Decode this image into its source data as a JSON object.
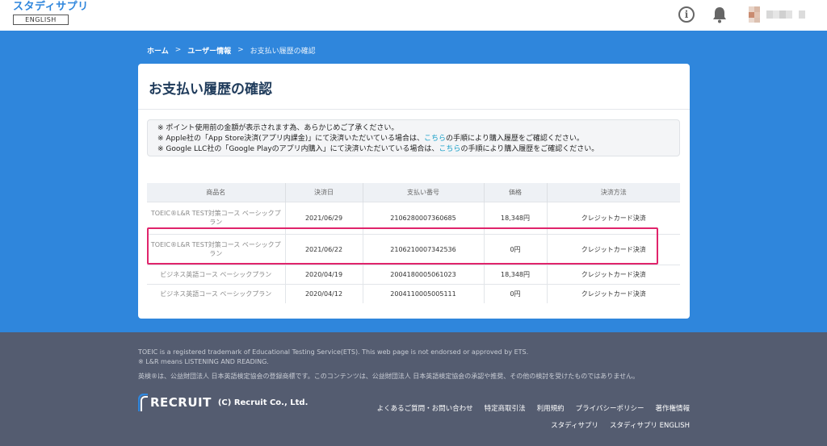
{
  "header": {
    "logo_text": "スタディサプリ",
    "logo_sub": "ENGLISH"
  },
  "breadcrumb": {
    "home": "ホーム",
    "user_info": "ユーザー情報",
    "current": "お支払い履歴の確認",
    "separator": ">"
  },
  "page": {
    "title": "お支払い履歴の確認"
  },
  "notice": {
    "line1": "※ ポイント使用前の金額が表示されます為、あらかじめご了承ください。",
    "line2_pre": "※ Apple社の「App Store決済(アプリ内課金)」にて決済いただいている場合は、",
    "line2_link": "こちら",
    "line2_post": "の手順により購入履歴をご確認ください。",
    "line3_pre": "※ Google LLC社の「Google Playのアプリ内購入」にて決済いただいている場合は、",
    "line3_link": "こちら",
    "line3_post": "の手順により購入履歴をご確認ください。"
  },
  "table": {
    "headers": [
      "商品名",
      "決済日",
      "支払い番号",
      "価格",
      "決済方法"
    ],
    "rows": [
      {
        "product": "TOEIC®L&R TEST対策コース ベーシックプラン",
        "date": "2021/06/29",
        "number": "2106280007360685",
        "price": "18,348円",
        "method": "クレジットカード決済"
      },
      {
        "product": "TOEIC®L&R TEST対策コース ベーシックプラン",
        "date": "2021/06/22",
        "number": "2106210007342536",
        "price": "0円",
        "method": "クレジットカード決済"
      },
      {
        "product": "ビジネス英語コース ベーシックプラン",
        "date": "2020/04/19",
        "number": "2004180005061023",
        "price": "18,348円",
        "method": "クレジットカード決済"
      },
      {
        "product": "ビジネス英語コース ベーシックプラン",
        "date": "2020/04/12",
        "number": "2004110005005111",
        "price": "0円",
        "method": "クレジットカード決済"
      }
    ]
  },
  "footer": {
    "trademark1": "TOEIC is a registered trademark of Educational Testing Service(ETS). This web page is not endorsed or approved by ETS.",
    "trademark2": "※ L&R means LISTENING AND READING.",
    "trademark3": "英検®は、公益財団法人 日本英語検定協会の登録商標です。このコンテンツは、公益財団法人 日本英語検定協会の承認や推奨、その他の検討を受けたものではありません。",
    "recruit_word": "RECRUIT",
    "copyright": "(C) Recruit Co., Ltd.",
    "links_row1": [
      "よくあるご質問・お問い合わせ",
      "特定商取引法",
      "利用規約",
      "プライバシーポリシー",
      "著作権情報"
    ],
    "links_row2": [
      "スタディサプリ",
      "スタディサプリ ENGLISH"
    ]
  },
  "colors": {
    "brand_blue": "#2f86dc",
    "highlight": "#e0246b",
    "footer_bg": "#545c70",
    "link": "#1aa0c8"
  }
}
